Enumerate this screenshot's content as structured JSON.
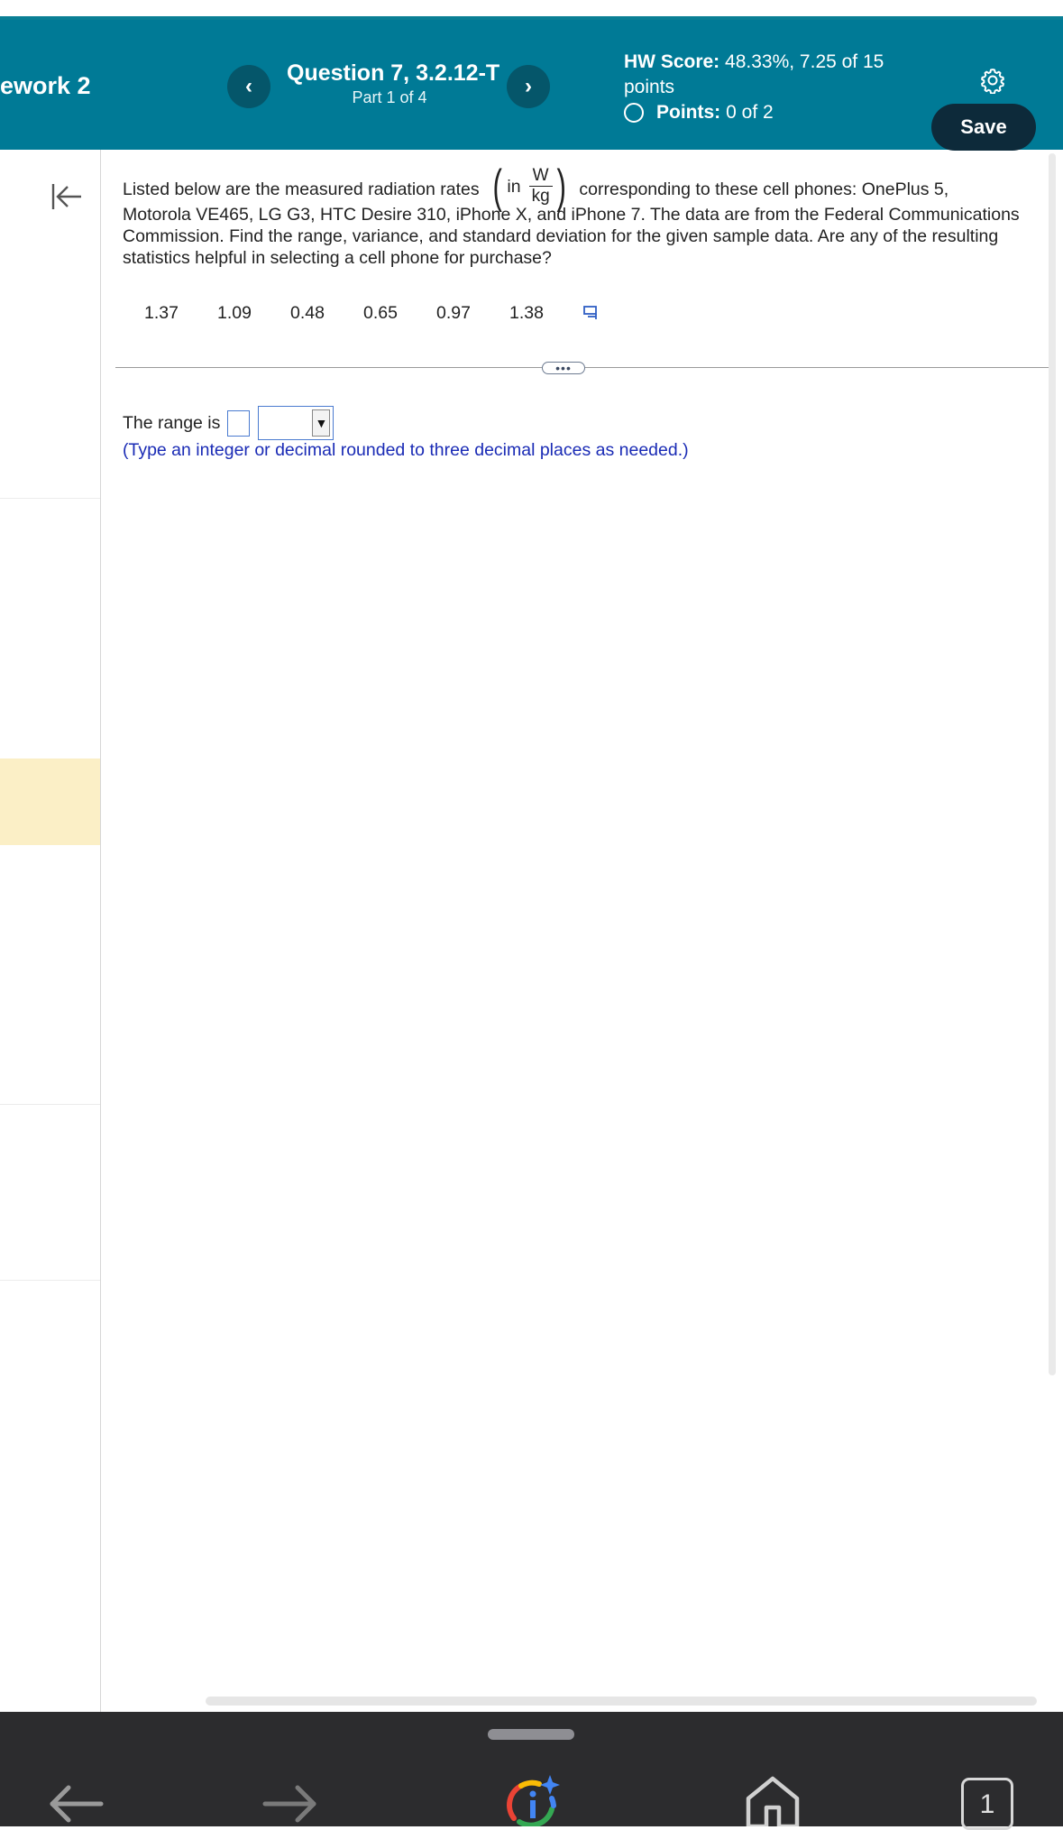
{
  "header": {
    "assignment_title": "ework 2",
    "question_title": "Question 7, 3.2.12-T",
    "part_label": "Part 1 of 4",
    "prev_label": "‹",
    "next_label": "›",
    "hw_score_label": "HW Score:",
    "hw_score_value": "48.33%, 7.25 of 15",
    "hw_score_unit": "points",
    "points_label": "Points:",
    "points_value": "0 of 2",
    "save_label": "Save"
  },
  "question": {
    "text_before_fraction": "Listed below are the measured radiation rates",
    "fraction_prefix": "in",
    "fraction_numerator": "W",
    "fraction_denominator": "kg",
    "text_after_fraction": "corresponding to these cell phones: OnePlus 5,",
    "text_rest": "Motorola VE465, LG G3, HTC Desire 310, iPhone X, and iPhone 7. The data are from the Federal Communications Commission. Find the range, variance, and standard deviation for the given sample data. Are any of the resulting statistics helpful in selecting a cell phone for purchase?",
    "data_values": [
      "1.37",
      "1.09",
      "0.48",
      "0.65",
      "0.97",
      "1.38"
    ],
    "more_label": "•••"
  },
  "answer": {
    "range_label": "The range is",
    "range_value": "",
    "unit_selected": "",
    "hint": "(Type an integer or decimal rounded to three decimal places as needed.)"
  },
  "navbar": {
    "tab_count": "1"
  },
  "colors": {
    "header_bg": "#007a96",
    "save_bg": "#0d2a3a",
    "hint_color": "#1a2bb5",
    "input_border": "#4a7bd0",
    "rail_highlight": "#fbefc6"
  },
  "icons": {
    "prev": "chevron-left-icon",
    "next": "chevron-right-icon",
    "settings": "gear-icon",
    "collapse": "collapse-left-icon",
    "copy": "copy-data-icon",
    "back": "arrow-left-icon",
    "forward": "arrow-right-icon",
    "lens": "google-lens-icon",
    "home": "home-icon",
    "tabs": "tabs-icon"
  }
}
